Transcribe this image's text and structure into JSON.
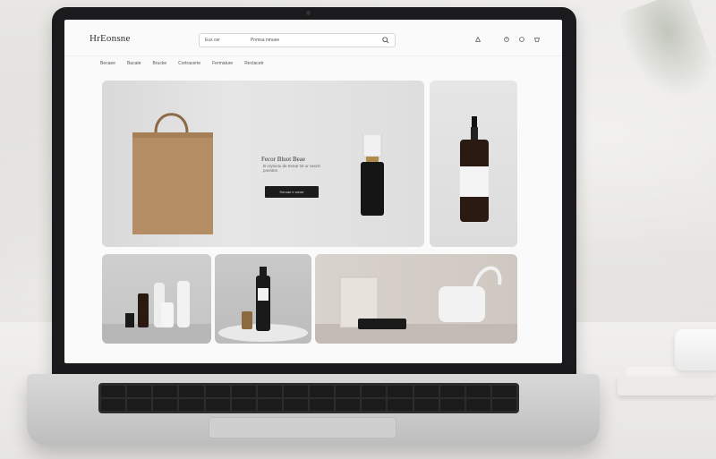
{
  "site": {
    "logo": "HrEonsne",
    "search": {
      "text_left": "Eux cer",
      "text_right": "Pnmsa nmuee"
    },
    "menu": [
      "Becaee",
      "Bacate",
      "Brucke",
      "Cortracerte",
      "Fermature",
      "Rectacetr"
    ],
    "hero": {
      "title": "Fecor Bluot Beae",
      "subtitle": "B orytoctu de tnrear lot ur neorrt ponntes",
      "button": "Seruae e weutr"
    }
  },
  "colors": {
    "button_bg": "#1c1c1c",
    "bezel": "#1b1b1d"
  }
}
